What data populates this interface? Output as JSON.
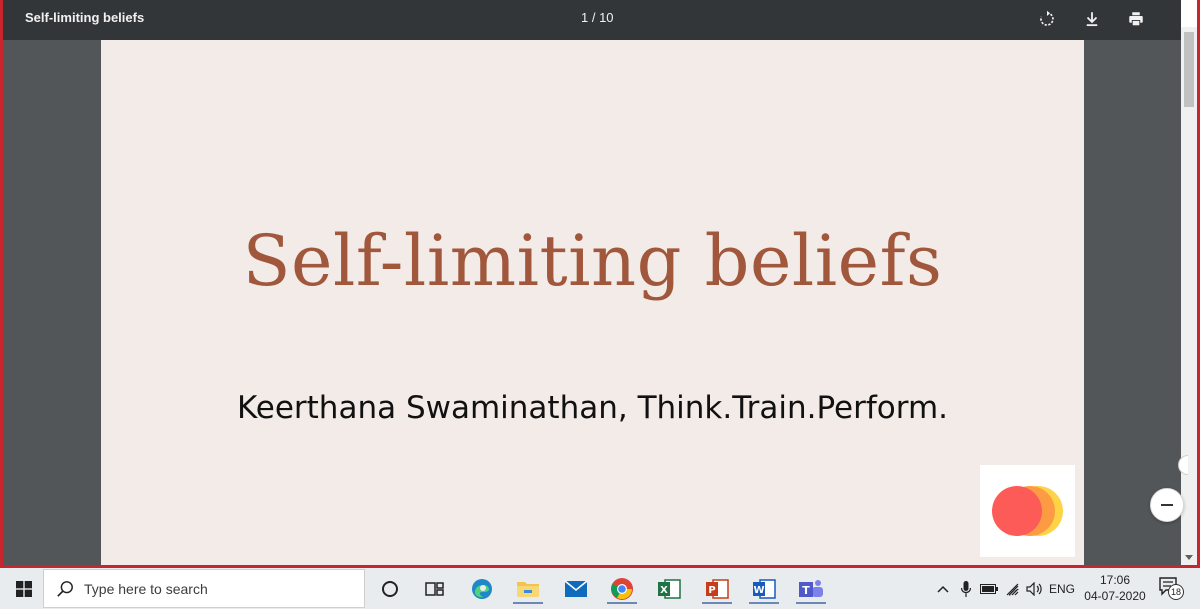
{
  "pdf": {
    "title": "Self-limiting beliefs",
    "page_indicator": "1 / 10",
    "toolbar": {
      "rotate_icon": "rotate-icon",
      "download_icon": "download-icon",
      "print_icon": "print-icon"
    }
  },
  "slide": {
    "title": "Self-limiting beliefs",
    "subtitle": "Keerthana Swaminathan, Think.Train.Perform."
  },
  "colors": {
    "title_color": "#a0573c",
    "page_bg": "#f3ebe8",
    "toolbar_bg": "#323639",
    "window_border": "#c8262e",
    "logo_red": "#fc5b57",
    "logo_orange": "#fd9b42",
    "logo_yellow": "#fed347"
  },
  "taskbar": {
    "search_placeholder": "Type here to search",
    "apps": [
      "cortana-icon",
      "task-view-icon",
      "edge-icon",
      "file-explorer-icon",
      "mail-icon",
      "chrome-icon",
      "excel-icon",
      "powerpoint-icon",
      "word-icon",
      "teams-icon"
    ],
    "tray": {
      "language": "ENG",
      "time": "17:06",
      "date": "04-07-2020",
      "notification_count": "18"
    }
  }
}
